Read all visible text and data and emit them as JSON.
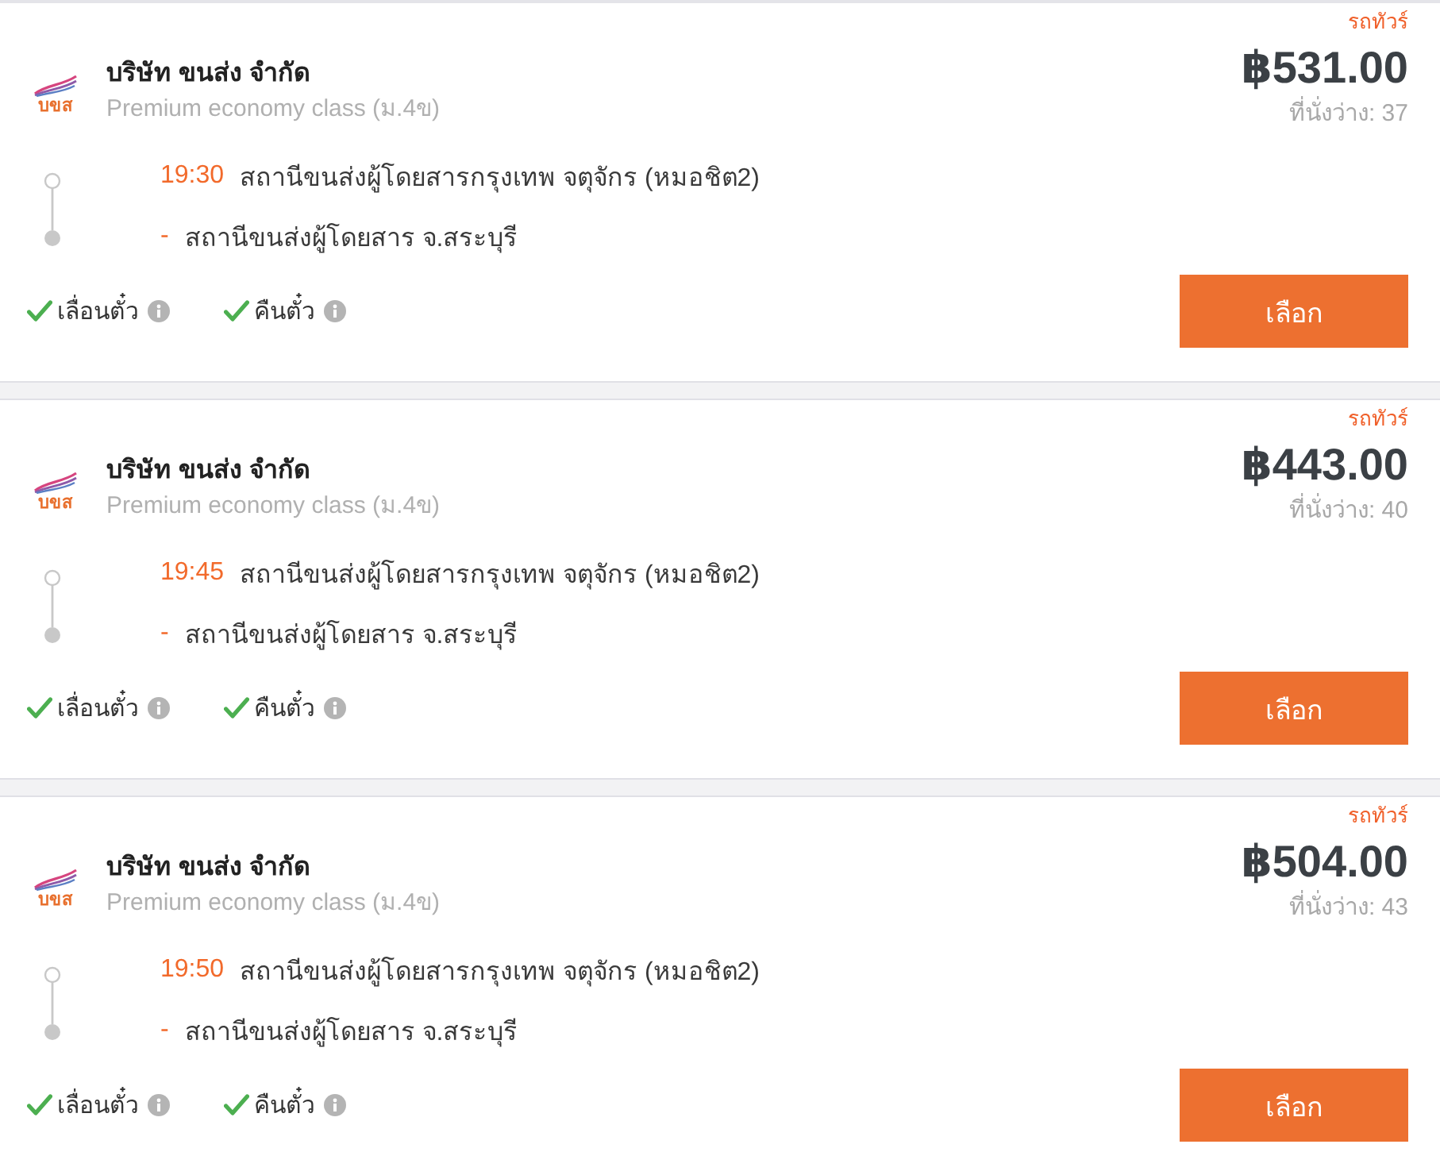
{
  "trips": [
    {
      "type_label": "รถทัวร์",
      "logo_text": "บขส",
      "company": "บริษัท ขนส่ง จำกัด",
      "class": "Premium economy class (ม.4ข)",
      "departure_time": "19:30",
      "origin": "สถานีขนส่งผู้โดยสารกรุงเทพ จตุจักร (หมอชิต2)",
      "arrival_time": "-",
      "destination": "สถานีขนส่งผู้โดยสาร จ.สระบุรี",
      "features": [
        {
          "label": "เลื่อนตั๋ว",
          "available": true
        },
        {
          "label": "คืนตั๋ว",
          "available": true
        }
      ],
      "price": "฿531.00",
      "seats": "ที่นั่งว่าง: 37",
      "button": "เลือก"
    },
    {
      "type_label": "รถทัวร์",
      "logo_text": "บขส",
      "company": "บริษัท ขนส่ง จำกัด",
      "class": "Premium economy class (ม.4ข)",
      "departure_time": "19:45",
      "origin": "สถานีขนส่งผู้โดยสารกรุงเทพ จตุจักร (หมอชิต2)",
      "arrival_time": "-",
      "destination": "สถานีขนส่งผู้โดยสาร จ.สระบุรี",
      "features": [
        {
          "label": "เลื่อนตั๋ว",
          "available": true
        },
        {
          "label": "คืนตั๋ว",
          "available": true
        }
      ],
      "price": "฿443.00",
      "seats": "ที่นั่งว่าง: 40",
      "button": "เลือก"
    },
    {
      "type_label": "รถทัวร์",
      "logo_text": "บขส",
      "company": "บริษัท ขนส่ง จำกัด",
      "class": "Premium economy class (ม.4ข)",
      "departure_time": "19:50",
      "origin": "สถานีขนส่งผู้โดยสารกรุงเทพ จตุจักร (หมอชิต2)",
      "arrival_time": "-",
      "destination": "สถานีขนส่งผู้โดยสาร จ.สระบุรี",
      "features": [
        {
          "label": "เลื่อนตั๋ว",
          "available": true
        },
        {
          "label": "คืนตั๋ว",
          "available": true
        }
      ],
      "price": "฿504.00",
      "seats": "ที่นั่งว่าง: 43",
      "button": "เลือก"
    }
  ]
}
